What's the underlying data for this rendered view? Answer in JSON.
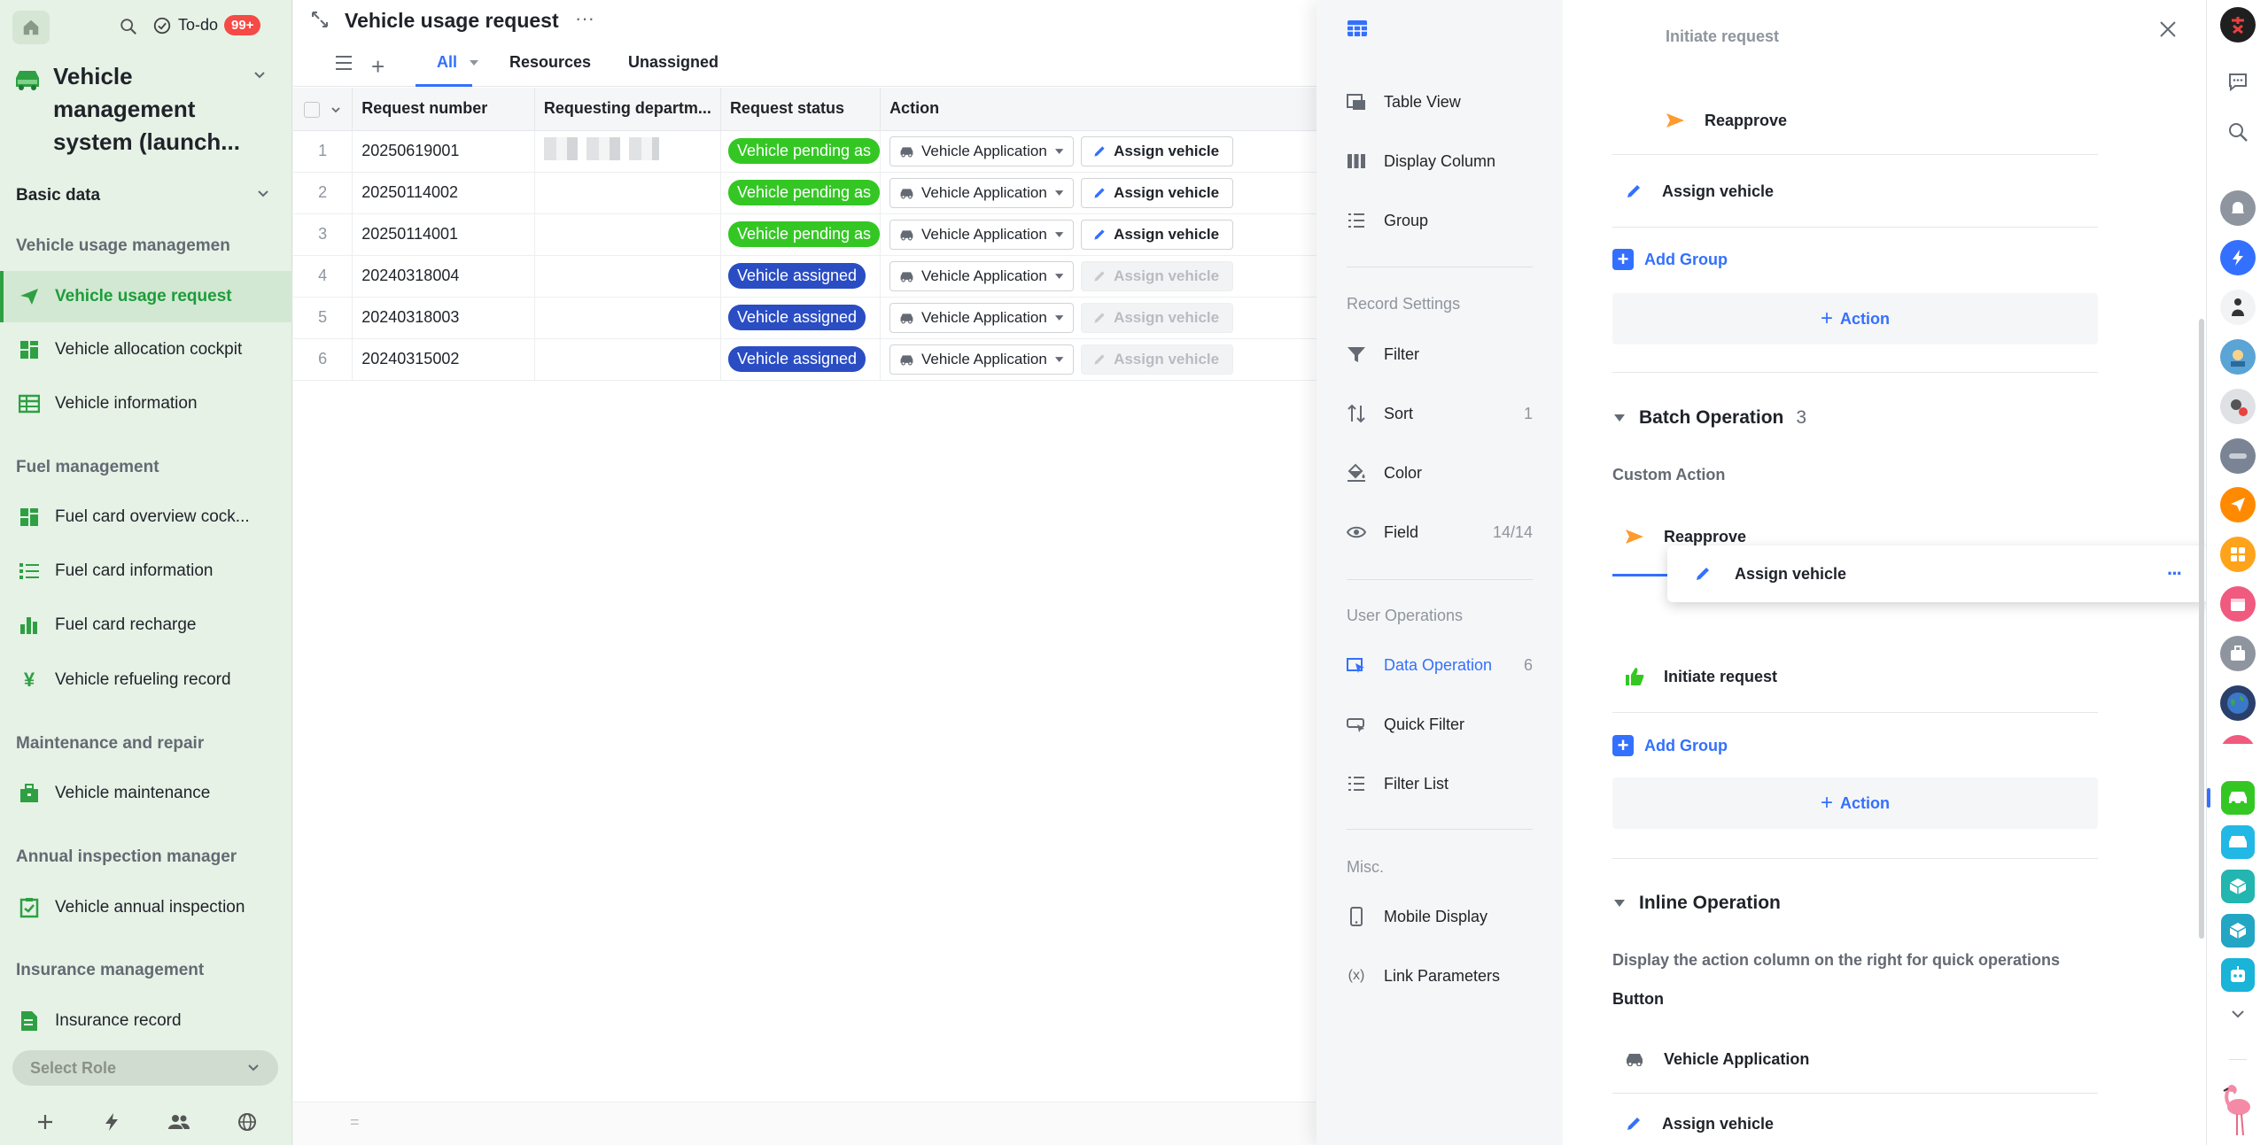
{
  "sidebar": {
    "todo_label": "To-do",
    "todo_badge": "99+",
    "app_title": "Vehicle management system (launch...",
    "basic_data": "Basic data",
    "sections": [
      {
        "title": "Vehicle usage managemen"
      },
      {
        "title": "Fuel management"
      },
      {
        "title": "Maintenance and repair"
      },
      {
        "title": "Annual inspection manager"
      },
      {
        "title": "Insurance management"
      }
    ],
    "items": [
      {
        "label": "Vehicle usage request"
      },
      {
        "label": "Vehicle allocation cockpit"
      },
      {
        "label": "Vehicle information"
      },
      {
        "label": "Fuel card overview cock..."
      },
      {
        "label": "Fuel card information"
      },
      {
        "label": "Fuel card recharge"
      },
      {
        "label": "Vehicle refueling record"
      },
      {
        "label": "Vehicle maintenance"
      },
      {
        "label": "Vehicle annual inspection"
      },
      {
        "label": "Insurance record"
      }
    ],
    "select_role": "Select Role"
  },
  "main": {
    "title": "Vehicle usage request",
    "tabs": [
      {
        "label": "All"
      },
      {
        "label": "Resources"
      },
      {
        "label": "Unassigned"
      }
    ],
    "columns": [
      "Request number",
      "Requesting departm...",
      "Request status",
      "Action"
    ],
    "rows": [
      {
        "idx": "1",
        "number": "20250619001",
        "status": "Vehicle pending as",
        "status_color": "#34c724",
        "action": "Vehicle Application",
        "button": "Assign vehicle"
      },
      {
        "idx": "2",
        "number": "20250114002",
        "status": "Vehicle pending as",
        "status_color": "#34c724",
        "action": "Vehicle Application",
        "button": "Assign vehicle"
      },
      {
        "idx": "3",
        "number": "20250114001",
        "status": "Vehicle pending as",
        "status_color": "#34c724",
        "action": "Vehicle Application",
        "button": "Assign vehicle"
      },
      {
        "idx": "4",
        "number": "20240318004",
        "status": "Vehicle assigned",
        "status_color": "#2a4dc4",
        "action": "Vehicle Application",
        "button": "Assign vehicle"
      },
      {
        "idx": "5",
        "number": "20240318003",
        "status": "Vehicle assigned",
        "status_color": "#2a4dc4",
        "action": "Vehicle Application",
        "button": "Assign vehicle"
      },
      {
        "idx": "6",
        "number": "20240315002",
        "status": "Vehicle assigned",
        "status_color": "#2a4dc4",
        "action": "Vehicle Application",
        "button": "Assign vehicle"
      }
    ],
    "footer": "="
  },
  "panel": {
    "menu": {
      "table_view": "Table View",
      "display_column": "Display Column",
      "group": "Group",
      "record_settings": "Record Settings",
      "filter": "Filter",
      "sort": "Sort",
      "sort_count": "1",
      "color": "Color",
      "field": "Field",
      "field_count": "14/14",
      "user_operations": "User Operations",
      "data_operation": "Data Operation",
      "data_operation_count": "6",
      "quick_filter": "Quick Filter",
      "filter_list": "Filter List",
      "misc": "Misc.",
      "mobile_display": "Mobile Display",
      "link_parameters": "Link Parameters"
    },
    "content": {
      "top_partial": "Initiate request",
      "reapprove_1": "Reapprove",
      "assign_vehicle_1": "Assign vehicle",
      "add_group": "Add Group",
      "action": "Action",
      "batch_title": "Batch Operation",
      "batch_count": "3",
      "custom_action": "Custom Action",
      "reapprove_2": "Reapprove",
      "dragging": "Assign vehicle",
      "initiate_request": "Initiate request",
      "inline_title": "Inline Operation",
      "inline_desc": "Display the action column on the right for quick operations",
      "button_label": "Button",
      "vehicle_application": "Vehicle Application",
      "assign_vehicle_2": "Assign vehicle"
    }
  },
  "colors": {
    "accent": "#3370ff",
    "brand_green": "#2ea043",
    "status_green": "#34c724",
    "status_blue": "#2a4dc4"
  }
}
